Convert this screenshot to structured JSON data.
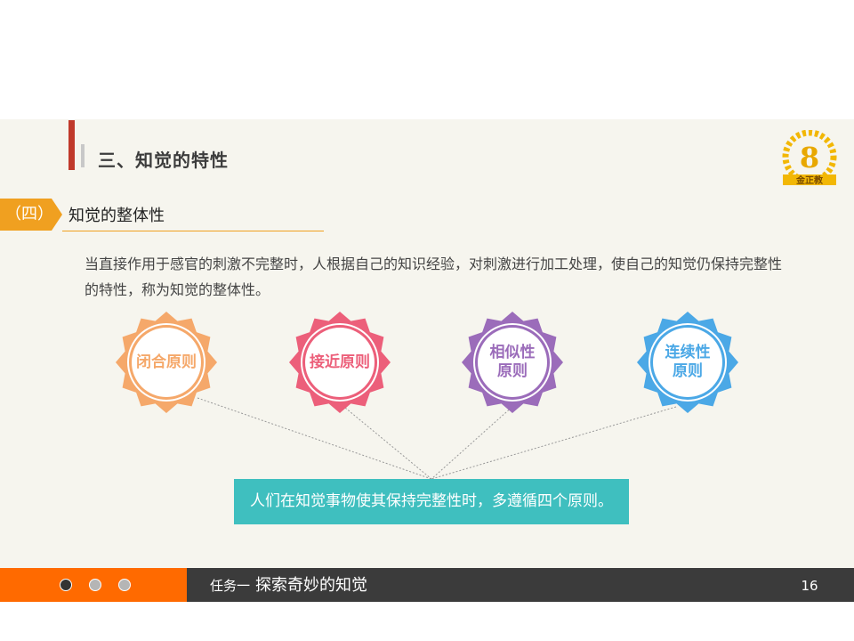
{
  "header": {
    "section_title": "三、知觉的特性",
    "logo_text": "金正教"
  },
  "subsection": {
    "tag": "（四）",
    "title": "知觉的整体性"
  },
  "definition": "当直接作用于感官的刺激不完整时，人根据自己的知识经验，对刺激进行加工处理，使自己的知觉仍保持完整性的特性，称为知觉的整体性。",
  "principles": [
    {
      "label": "闭合原则",
      "color": "#f5a86a"
    },
    {
      "label": "接近原则",
      "color": "#ec5f7a"
    },
    {
      "label": "相似性\n原则",
      "color": "#9b6cba"
    },
    {
      "label": "连续性\n原则",
      "color": "#4ba8e6"
    }
  ],
  "callout": "人们在知觉事物使其保持完整性时，多遵循四个原则。",
  "footer": {
    "task": "任务一",
    "topic": "探索奇妙的知觉",
    "page": "16"
  },
  "colors": {
    "accent_orange": "#ff6a00",
    "header_red": "#c0392b",
    "callout_teal": "#3fbfbf",
    "footer_dark": "#3b3b3b"
  }
}
